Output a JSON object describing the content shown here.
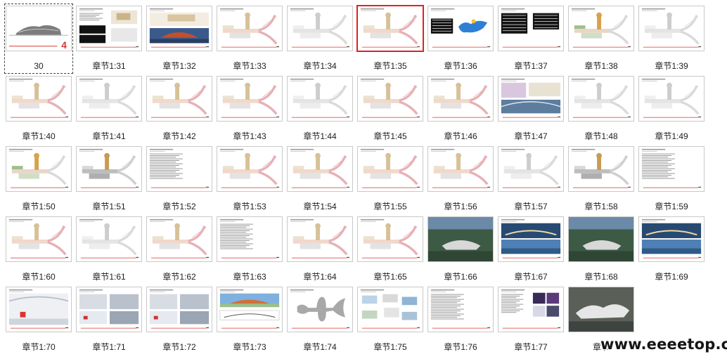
{
  "slides": [
    {
      "label": "30",
      "kind": "cover",
      "state": "focused",
      "cover_mark": "4"
    },
    {
      "label": "章节1:31",
      "kind": "mixed"
    },
    {
      "label": "章节1:32",
      "kind": "render"
    },
    {
      "label": "章节1:33",
      "kind": "plan"
    },
    {
      "label": "章节1:34",
      "kind": "plan-gray"
    },
    {
      "label": "章节1:35",
      "kind": "plan",
      "state": "selected"
    },
    {
      "label": "章节1:36",
      "kind": "table-blue"
    },
    {
      "label": "章节1:37",
      "kind": "tables"
    },
    {
      "label": "章节1:38",
      "kind": "plan-color"
    },
    {
      "label": "章节1:39",
      "kind": "plan-gray"
    },
    {
      "label": "章节1:40",
      "kind": "plan"
    },
    {
      "label": "章节1:41",
      "kind": "plan-gray"
    },
    {
      "label": "章节1:42",
      "kind": "plan"
    },
    {
      "label": "章节1:43",
      "kind": "plan"
    },
    {
      "label": "章节1:44",
      "kind": "plan-gray"
    },
    {
      "label": "章节1:45",
      "kind": "plan"
    },
    {
      "label": "章节1:46",
      "kind": "plan"
    },
    {
      "label": "章节1:47",
      "kind": "photos"
    },
    {
      "label": "章节1:48",
      "kind": "plan-gray"
    },
    {
      "label": "章节1:49",
      "kind": "plan-gray"
    },
    {
      "label": "章节1:50",
      "kind": "plan-color"
    },
    {
      "label": "章节1:51",
      "kind": "plan-dark"
    },
    {
      "label": "章节1:52",
      "kind": "text"
    },
    {
      "label": "章节1:53",
      "kind": "plan"
    },
    {
      "label": "章节1:54",
      "kind": "plan"
    },
    {
      "label": "章节1:55",
      "kind": "plan"
    },
    {
      "label": "章节1:56",
      "kind": "plan"
    },
    {
      "label": "章节1:57",
      "kind": "plan-gray"
    },
    {
      "label": "章节1:58",
      "kind": "plan-dark"
    },
    {
      "label": "章节1:59",
      "kind": "text"
    },
    {
      "label": "章节1:60",
      "kind": "plan"
    },
    {
      "label": "章节1:61",
      "kind": "plan-gray"
    },
    {
      "label": "章节1:62",
      "kind": "plan"
    },
    {
      "label": "章节1:63",
      "kind": "text"
    },
    {
      "label": "章节1:64",
      "kind": "plan"
    },
    {
      "label": "章节1:65",
      "kind": "plan"
    },
    {
      "label": "章节1:66",
      "kind": "aerial"
    },
    {
      "label": "章节1:67",
      "kind": "split-photo"
    },
    {
      "label": "章节1:68",
      "kind": "aerial"
    },
    {
      "label": "章节1:69",
      "kind": "split-photo"
    },
    {
      "label": "章节1:70",
      "kind": "interior"
    },
    {
      "label": "章节1:71",
      "kind": "photo-grid"
    },
    {
      "label": "章节1:72",
      "kind": "photo-grid"
    },
    {
      "label": "章节1:73",
      "kind": "elevation"
    },
    {
      "label": "章节1:74",
      "kind": "shape"
    },
    {
      "label": "章节1:75",
      "kind": "small-photos"
    },
    {
      "label": "章节1:76",
      "kind": "text"
    },
    {
      "label": "章节1:77",
      "kind": "text-photos"
    },
    {
      "label": "章节",
      "kind": "aerial-dark"
    }
  ],
  "colors": {
    "selected_border": "#e3211e",
    "footer_red": "#d8332f"
  },
  "watermark": "www.eeeetop.com"
}
